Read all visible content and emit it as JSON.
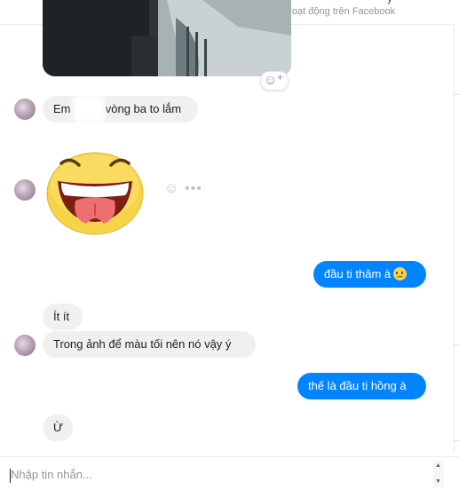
{
  "header": {
    "status": "Hoạt động trên Facebook",
    "cut_glyph": "y"
  },
  "photo_reaction": {
    "icon": "smile-plus-icon",
    "smile": "☺",
    "plus": "+"
  },
  "messages": [
    {
      "side": "in",
      "text_start": "Em",
      "text_end": "vòng ba to lắm"
    },
    {
      "side": "in",
      "type": "sticker",
      "sticker": "tongue-out-laughing-sticker"
    },
    {
      "side": "out",
      "text": "đầu ti thâm à",
      "emoji": "sad-face-icon"
    },
    {
      "side": "in",
      "text": "Ít ít"
    },
    {
      "side": "in",
      "text": "Trong ảnh để màu tối nên nó vậy ý"
    },
    {
      "side": "out",
      "text": "thế là đầu ti hồng à"
    },
    {
      "side": "in",
      "text": "Ừ"
    }
  ],
  "sticker_tools": {
    "react_icon": "☺",
    "more_icon": "•••"
  },
  "composer": {
    "placeholder": "Nhập tin nhắn..."
  },
  "colors": {
    "outgoing": "#0084ff",
    "incoming": "#f1f0f0",
    "meta_text": "#90949c"
  }
}
